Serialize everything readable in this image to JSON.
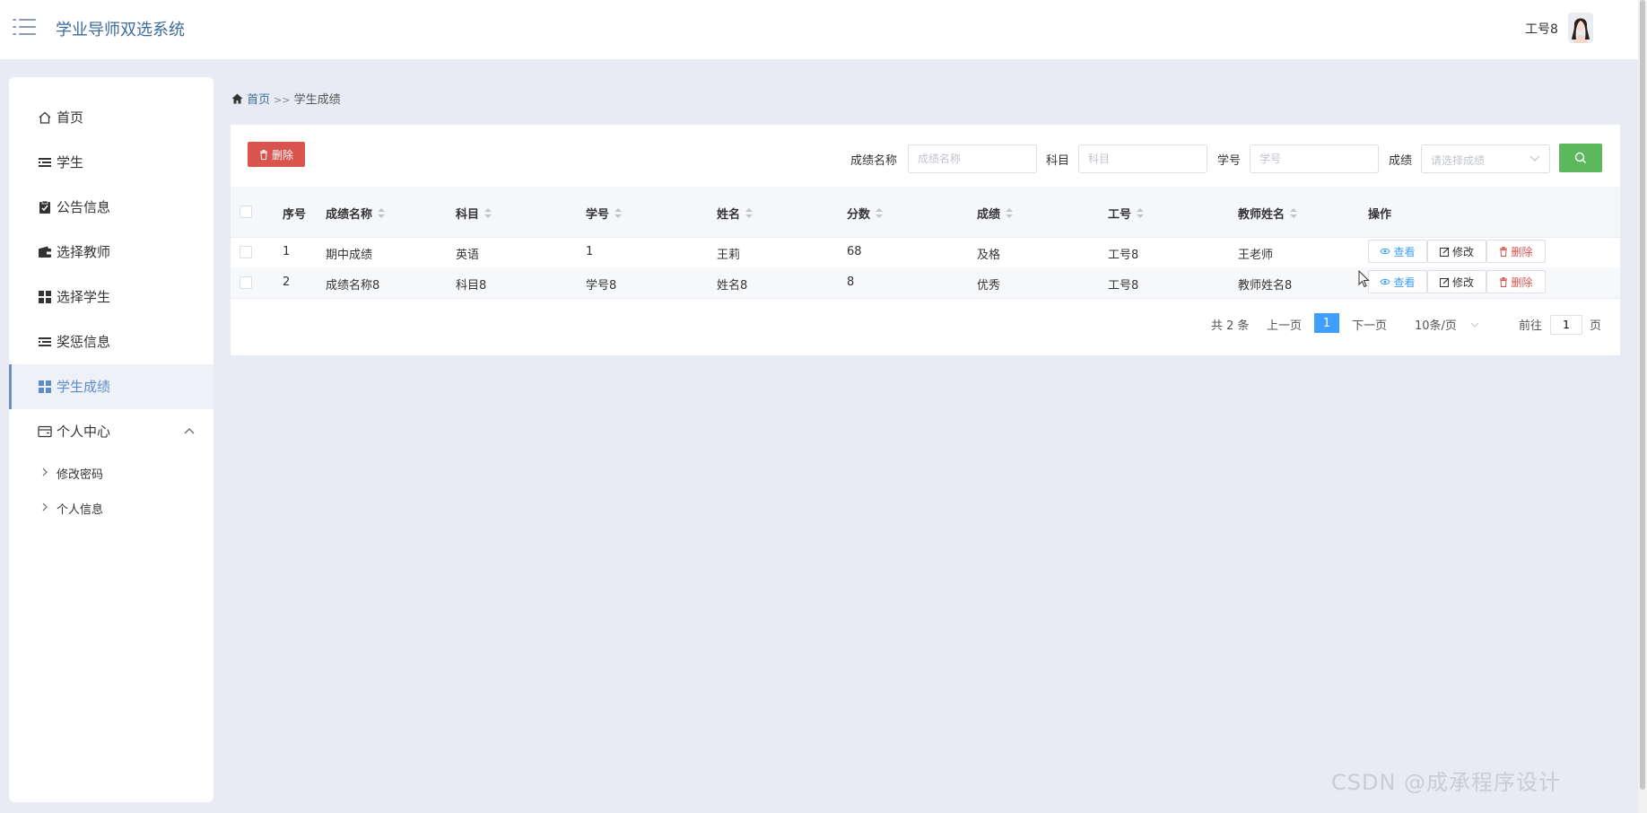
{
  "header": {
    "app_title": "学业导师双选系统",
    "user_name": "工号8"
  },
  "sidebar": {
    "items": [
      {
        "label": "首页",
        "icon": "home-icon"
      },
      {
        "label": "学生",
        "icon": "list-icon"
      },
      {
        "label": "公告信息",
        "icon": "clipboard-icon"
      },
      {
        "label": "选择教师",
        "icon": "wallet-icon"
      },
      {
        "label": "选择学生",
        "icon": "grid-icon"
      },
      {
        "label": "奖惩信息",
        "icon": "list-icon"
      },
      {
        "label": "学生成绩",
        "icon": "grid-icon",
        "active": true
      },
      {
        "label": "个人中心",
        "icon": "card-icon",
        "expanded": true
      }
    ],
    "sub_items": [
      {
        "label": "修改密码"
      },
      {
        "label": "个人信息"
      }
    ]
  },
  "breadcrumb": {
    "home": "首页",
    "separator": ">>",
    "current": "学生成绩"
  },
  "toolbar": {
    "delete_label": "删除"
  },
  "filters": {
    "name_label": "成绩名称",
    "name_placeholder": "成绩名称",
    "subject_label": "科目",
    "subject_placeholder": "科目",
    "student_no_label": "学号",
    "student_no_placeholder": "学号",
    "grade_label": "成绩",
    "grade_placeholder": "请选择成绩"
  },
  "table": {
    "columns": [
      "序号",
      "成绩名称",
      "科目",
      "学号",
      "姓名",
      "分数",
      "成绩",
      "工号",
      "教师姓名",
      "操作"
    ],
    "rows": [
      {
        "index": "1",
        "name": "期中成绩",
        "subject": "英语",
        "student_no": "1",
        "student_name": "王莉",
        "score": "68",
        "grade": "及格",
        "teacher_no": "工号8",
        "teacher_name": "王老师"
      },
      {
        "index": "2",
        "name": "成绩名称8",
        "subject": "科目8",
        "student_no": "学号8",
        "student_name": "姓名8",
        "score": "8",
        "grade": "优秀",
        "teacher_no": "工号8",
        "teacher_name": "教师姓名8"
      }
    ],
    "actions": {
      "view": "查看",
      "edit": "修改",
      "delete": "删除"
    }
  },
  "pagination": {
    "total": "共 2 条",
    "prev": "上一页",
    "current_page": "1",
    "next": "下一页",
    "page_size": "10条/页",
    "goto_label": "前往",
    "goto_value": "1",
    "page_unit": "页"
  },
  "watermark": "CSDN @成承程序设计",
  "colors": {
    "accent": "#409eff",
    "danger": "#d9534f",
    "success": "#5cb85c",
    "brand_text": "#3d6b9a",
    "active_nav": "#5b8bc9"
  }
}
